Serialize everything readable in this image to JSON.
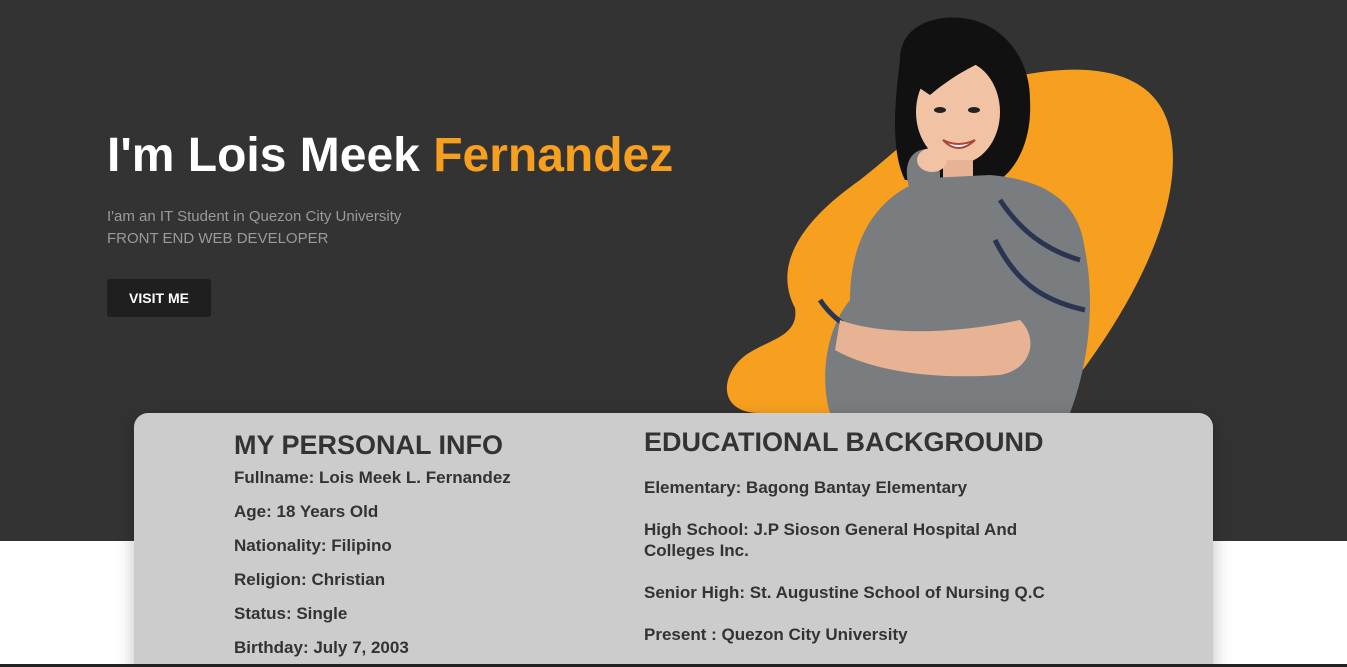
{
  "hero": {
    "title_prefix": "I'm Lois Meek ",
    "title_accent": "Fernandez",
    "subtitle_line1": "I'am an IT Student in Quezon City University",
    "subtitle_line2": "FRONT END WEB DEVELOPER",
    "button_label": "VISIT ME",
    "accent_color": "#f7a01f",
    "background_color": "#333333"
  },
  "personal_info": {
    "title": "MY PERSONAL INFO",
    "items": [
      "Fullname: Lois Meek L. Fernandez",
      "Age: 18 Years Old",
      "Nationality: Filipino",
      "Religion: Christian",
      "Status: Single",
      "Birthday: July 7, 2003"
    ]
  },
  "education": {
    "title": "EDUCATIONAL BACKGROUND",
    "items": [
      "Elementary: Bagong Bantay Elementary",
      "High School: J.P Sioson General Hospital And Colleges Inc.",
      "Senior High: St. Augustine School of Nursing Q.C",
      "Present : Quezon City University"
    ]
  },
  "card_color": "#cccccc"
}
